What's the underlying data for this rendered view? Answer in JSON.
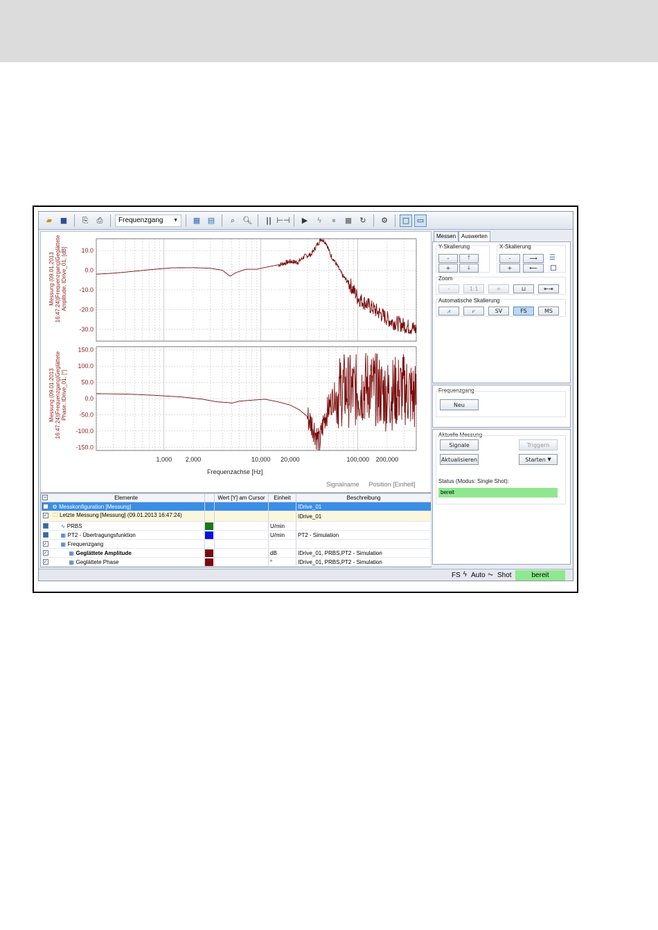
{
  "toolbar": {
    "combo_value": "Frequenzgang"
  },
  "chart_data": [
    {
      "type": "line",
      "ylabel": "Messung (09.01.2013\n16:47:24)|Frequenzgang|Geglättete\nAmplitude, IDrive_01, [dB]",
      "yticks": [
        "10.0",
        "0.0",
        "-10.0",
        "-20.0",
        "-30.0"
      ],
      "ylim": [
        -36,
        16
      ],
      "xscale": "log",
      "xlim": [
        200,
        400000
      ],
      "series": [
        {
          "color": "#7a0a0a",
          "x": [
            200,
            300,
            500,
            800,
            1200,
            2000,
            3000,
            4000,
            4800,
            5500,
            7000,
            9000,
            12000,
            16000,
            20000,
            24000,
            28000,
            33000,
            38000,
            42000,
            47000,
            52000,
            60000,
            70000,
            85000,
            100000,
            130000,
            170000,
            220000,
            300000,
            400000
          ],
          "y": [
            -2,
            -1.5,
            -0.5,
            0.5,
            1.2,
            1.3,
            1,
            0,
            -3,
            -1.2,
            0.5,
            0.5,
            1.8,
            3,
            4.5,
            4,
            7,
            8,
            13,
            16,
            14,
            8,
            3,
            -3,
            -8,
            -14,
            -18,
            -22,
            -26,
            -28,
            -30
          ]
        }
      ]
    },
    {
      "type": "line",
      "ylabel": "Messung (09.01.2013\n16:47:24)|Frequenzgang|Geglättete\nPhase, IDrive_01, [°]",
      "yticks": [
        "150.0",
        "100.0",
        "50.0",
        "0.0",
        "-50.0",
        "-100.0",
        "-150.0"
      ],
      "ylim": [
        -160,
        160
      ],
      "xlabel": "Frequenzachse [Hz]",
      "xticks": [
        "1,000",
        "2,000",
        "10,000",
        "20,000",
        "100,000",
        "200,000"
      ],
      "xtick_values": [
        1000,
        2000,
        10000,
        20000,
        100000,
        200000
      ],
      "xscale": "log",
      "xlim": [
        200,
        400000
      ],
      "series": [
        {
          "color": "#7a0a0a",
          "x": [
            200,
            400,
            800,
            1500,
            2500,
            3500,
            4500,
            5000,
            6000,
            8000,
            11000,
            15000,
            20000,
            25000,
            30000,
            35000,
            40000,
            45000,
            55000,
            70000,
            90000,
            130000,
            200000,
            300000,
            400000
          ],
          "y": [
            15,
            14,
            10,
            5,
            -2,
            -10,
            -12,
            -14,
            -8,
            -5,
            -2,
            -10,
            -20,
            -35,
            -55,
            -90,
            -140,
            -60,
            0,
            30,
            20,
            40,
            10,
            30,
            0
          ]
        }
      ]
    }
  ],
  "legend_footer": {
    "signalname": "Signalname",
    "position": "Position",
    "unit": "[Einheit]"
  },
  "grid": {
    "columns": [
      "Elemente",
      "Wert [Y] am Cursor",
      "Einheit",
      "Beschreibung"
    ],
    "rows": [
      {
        "name": "Messkonfiguration [Messung]",
        "unit": "",
        "desc": "IDrive_01",
        "color": "",
        "checked": false,
        "level": 0
      },
      {
        "name": "Letzte Messung [Messung] (09.01.2013 16:47:24)",
        "unit": "",
        "desc": "IDrive_01",
        "color": "",
        "checked": true,
        "level": 0
      },
      {
        "name": "PRBS",
        "unit": "U/min",
        "desc": "",
        "color": "#1a7a1a",
        "checked": false,
        "level": 1
      },
      {
        "name": "PT2 - Übertragungsfunktion",
        "unit": "U/min",
        "desc": "PT2 - Simulation",
        "color": "#0a10e0",
        "checked": false,
        "level": 1
      },
      {
        "name": "Frequenzgang",
        "unit": "",
        "desc": "",
        "color": "",
        "checked": true,
        "level": 1
      },
      {
        "name": "Geglättete Amplitude",
        "unit": "dB",
        "desc": "IDrive_01, PRBS,PT2 - Simulation",
        "color": "#7a0a0a",
        "checked": true,
        "level": 2
      },
      {
        "name": "Geglättete Phase",
        "unit": "°",
        "desc": "IDrive_01, PRBS,PT2 - Simulation",
        "color": "#7a0a0a",
        "checked": true,
        "level": 2
      }
    ]
  },
  "tabs": {
    "messen": "Messen",
    "auswerten": "Auswerten"
  },
  "scaling": {
    "y_label": "Y-Skalierung",
    "x_label": "X-Skalierung",
    "zoom_label": "Zoom",
    "zoom_minus": "-",
    "zoom_11": "1:1",
    "zoom_plus": "+",
    "auto_label": "Automatische Skalierung",
    "sv": "SV",
    "fs": "FS",
    "ms": "MS",
    "minus": "-",
    "plus": "+"
  },
  "frequenzgang": {
    "label": "Frequenzgang",
    "neu": "Neu"
  },
  "measurement": {
    "label": "Aktuelle Messung",
    "signale": "Signale",
    "triggern": "Triggern",
    "aktualisieren": "Aktualisieren",
    "starten": "Starten",
    "status_label": "Status (Modus: Single Shot):",
    "status_value": "bereit"
  },
  "statusbar": {
    "fs": "FS",
    "auto": "Auto",
    "shot": "Shot",
    "state": "bereit",
    "state_color": "#8fe88f"
  }
}
